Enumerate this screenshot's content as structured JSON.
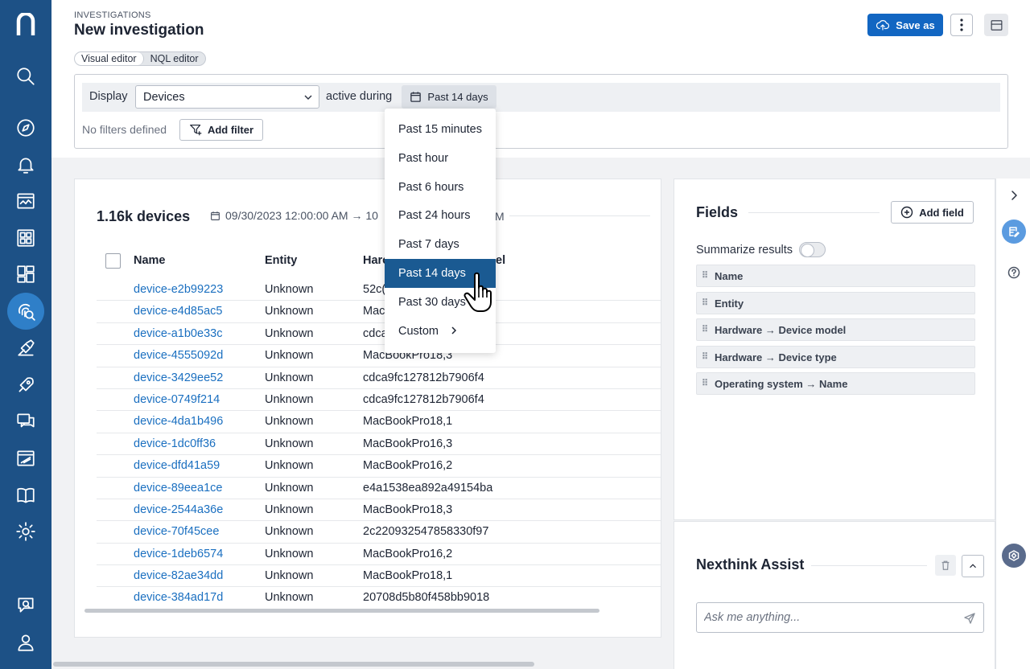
{
  "nav": {
    "logo": "n",
    "items": [
      "search",
      "explore",
      "alerts",
      "dashboards",
      "apps",
      "library",
      "investigations",
      "remote-actions",
      "campaigns",
      "engage",
      "reports",
      "documentation",
      "settings",
      "feedback",
      "profile"
    ],
    "active": "investigations"
  },
  "header": {
    "breadcrumb": "INVESTIGATIONS",
    "title": "New investigation",
    "save_label": "Save as",
    "editor_tabs": [
      "Visual editor",
      "NQL editor"
    ],
    "active_editor": "Visual editor"
  },
  "query": {
    "display_label": "Display",
    "table_value": "Devices",
    "during_label": "active during",
    "range_value": "Past 14 days",
    "no_filters": "No filters defined",
    "add_filter_label": "Add filter"
  },
  "results": {
    "count": "1.16k devices",
    "date_range": "09/30/2023 12:00:00 AM → 10",
    "date_range_tail": "M",
    "columns": [
      "Name",
      "Entity",
      "Harc",
      "el"
    ],
    "rows": [
      {
        "name": "device-e2b99223",
        "entity": "Unknown",
        "hw": "52c("
      },
      {
        "name": "device-e4d85ac5",
        "entity": "Unknown",
        "hw": "Mac"
      },
      {
        "name": "device-a1b0e33c",
        "entity": "Unknown",
        "hw": "cdca"
      },
      {
        "name": "device-4555092d",
        "entity": "Unknown",
        "hw": "MacBookPro18,3"
      },
      {
        "name": "device-3429ee52",
        "entity": "Unknown",
        "hw": "cdca9fc127812b7906f4"
      },
      {
        "name": "device-0749f214",
        "entity": "Unknown",
        "hw": "cdca9fc127812b7906f4"
      },
      {
        "name": "device-4da1b496",
        "entity": "Unknown",
        "hw": "MacBookPro18,1"
      },
      {
        "name": "device-1dc0ff36",
        "entity": "Unknown",
        "hw": "MacBookPro16,3"
      },
      {
        "name": "device-dfd41a59",
        "entity": "Unknown",
        "hw": "MacBookPro16,2"
      },
      {
        "name": "device-89eea1ce",
        "entity": "Unknown",
        "hw": "e4a1538ea892a49154ba"
      },
      {
        "name": "device-2544a36e",
        "entity": "Unknown",
        "hw": "MacBookPro18,3"
      },
      {
        "name": "device-70f45cee",
        "entity": "Unknown",
        "hw": "2c220932547858330f97"
      },
      {
        "name": "device-1deb6574",
        "entity": "Unknown",
        "hw": "MacBookPro16,2"
      },
      {
        "name": "device-82ae34dd",
        "entity": "Unknown",
        "hw": "MacBookPro18,1"
      },
      {
        "name": "device-384ad17d",
        "entity": "Unknown",
        "hw": "20708d5b80f458bb9018"
      }
    ]
  },
  "fields": {
    "title": "Fields",
    "add_label": "Add field",
    "summarize_label": "Summarize results",
    "summarize_on": false,
    "items": [
      "Name",
      "Entity",
      "Hardware → Device model",
      "Hardware → Device type",
      "Operating system → Name"
    ]
  },
  "assist": {
    "title": "Nexthink Assist",
    "placeholder": "Ask me anything..."
  },
  "dropdown": {
    "options": [
      "Past 15 minutes",
      "Past hour",
      "Past 6 hours",
      "Past 24 hours",
      "Past 7 days",
      "Past 14 days",
      "Past 30 days",
      "Custom"
    ],
    "selected": "Past 14 days"
  },
  "colors": {
    "rail": "#1d5186",
    "rail_active": "#2f7fc8",
    "primary": "#1266c2",
    "link": "#1a6fc0",
    "selected_option": "#1a5a92"
  }
}
